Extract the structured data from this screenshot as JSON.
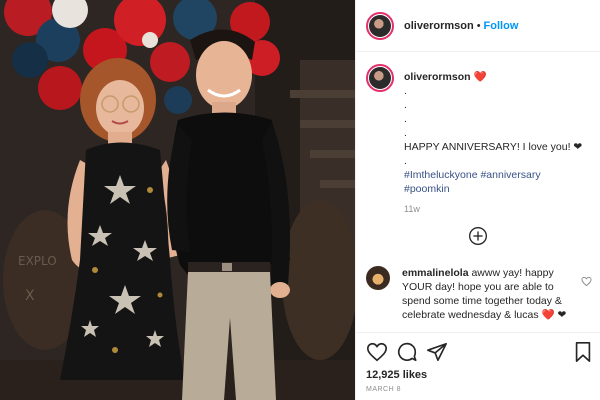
{
  "post": {
    "username": "oliverormson",
    "separator": "•",
    "follow_label": "Follow"
  },
  "caption": {
    "username": "oliverormson",
    "title_suffix": "❤️",
    "dots": [
      ".",
      ".",
      ".",
      "."
    ],
    "message": "HAPPY ANNIVERSARY! I love you! ❤",
    "dot_after": ".",
    "hashtags_line1": [
      "#Imtheluckyone",
      "#anniversary"
    ],
    "hashtags_line2": [
      "#poomkin"
    ],
    "time": "11w"
  },
  "comment": {
    "username": "emmalinelola",
    "text": "awww yay! happy YOUR day! hope you are able to spend some time together today & celebrate wednesday & lucas ❤️ ❤"
  },
  "stats": {
    "likes": "12,925 likes",
    "date": "MARCH 8"
  },
  "icons": [
    "heart-icon",
    "comment-icon",
    "share-icon",
    "bookmark-icon",
    "add-circle-icon",
    "small-heart-icon"
  ],
  "colors": {
    "link": "#0095f6",
    "hashtag": "#385185",
    "muted": "#8e8e8e",
    "text": "#262626"
  }
}
